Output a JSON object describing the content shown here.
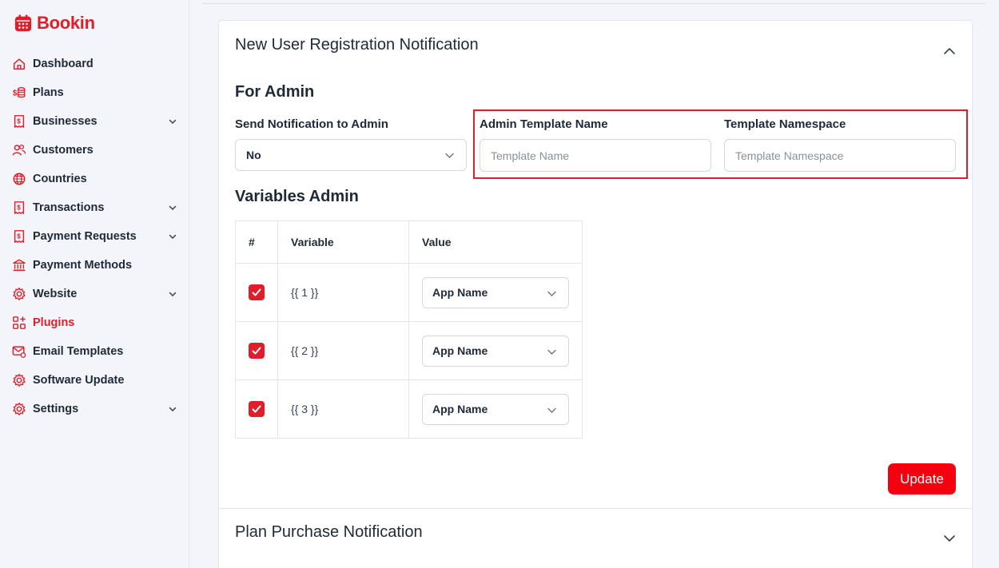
{
  "brand": {
    "name": "Bookin",
    "color": "#e11d2a"
  },
  "sidebar": {
    "items": [
      {
        "label": "Dashboard",
        "icon": "home-icon",
        "has_chevron": false,
        "active": false
      },
      {
        "label": "Plans",
        "icon": "coins-icon",
        "has_chevron": false,
        "active": false
      },
      {
        "label": "Businesses",
        "icon": "receipt-icon",
        "has_chevron": true,
        "active": false
      },
      {
        "label": "Customers",
        "icon": "users-icon",
        "has_chevron": false,
        "active": false
      },
      {
        "label": "Countries",
        "icon": "globe-icon",
        "has_chevron": false,
        "active": false
      },
      {
        "label": "Transactions",
        "icon": "receipt-icon",
        "has_chevron": true,
        "active": false
      },
      {
        "label": "Payment Requests",
        "icon": "receipt-icon",
        "has_chevron": true,
        "active": false
      },
      {
        "label": "Payment Methods",
        "icon": "bank-icon",
        "has_chevron": false,
        "active": false
      },
      {
        "label": "Website",
        "icon": "gear-icon",
        "has_chevron": true,
        "active": false
      },
      {
        "label": "Plugins",
        "icon": "grid-plus-icon",
        "has_chevron": false,
        "active": true
      },
      {
        "label": "Email Templates",
        "icon": "mail-gear-icon",
        "has_chevron": false,
        "active": false
      },
      {
        "label": "Software Update",
        "icon": "gear-icon",
        "has_chevron": false,
        "active": false
      },
      {
        "label": "Settings",
        "icon": "gear-icon",
        "has_chevron": true,
        "active": false
      }
    ]
  },
  "main": {
    "section1": {
      "title": "New User Registration Notification",
      "expanded": true,
      "subheading": "For Admin",
      "send_label": "Send Notification to Admin",
      "send_value": "No",
      "template_name_label": "Admin Template Name",
      "template_name_placeholder": "Template Name",
      "template_name_value": "",
      "namespace_label": "Template Namespace",
      "namespace_placeholder": "Template Namespace",
      "namespace_value": "",
      "variables_heading": "Variables Admin",
      "table": {
        "headers": [
          "#",
          "Variable",
          "Value"
        ],
        "rows": [
          {
            "checked": true,
            "variable": "{{ 1 }}",
            "value": "App Name"
          },
          {
            "checked": true,
            "variable": "{{ 2 }}",
            "value": "App Name"
          },
          {
            "checked": true,
            "variable": "{{ 3 }}",
            "value": "App Name"
          }
        ]
      },
      "update_label": "Update"
    },
    "section2": {
      "title": "Plan Purchase Notification",
      "expanded": false
    }
  },
  "colors": {
    "accent": "#e11d2a",
    "button": "#f5000f",
    "sidebar_bg": "#f4f5fa"
  }
}
